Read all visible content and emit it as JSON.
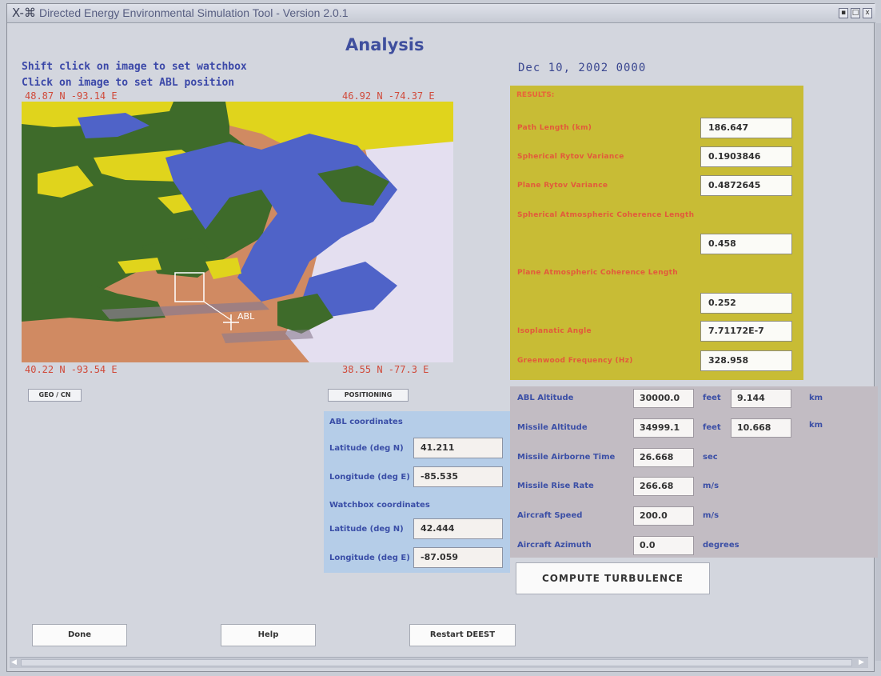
{
  "window": {
    "title": "Directed Energy Environmental Simulation Tool - Version 2.0.1",
    "controls": [
      "▪",
      "□",
      "x"
    ]
  },
  "heading": "Analysis",
  "instructions": {
    "watchbox": "Shift click on image to set watchbox",
    "abl": "Click on image to set ABL position"
  },
  "map": {
    "corners": {
      "top_left": "48.87 N  -93.14 E",
      "top_right": "46.92 N  -74.37 E",
      "bottom_left": "40.22 N  -93.54 E",
      "bottom_right": "38.55 N  -77.3 E"
    },
    "abl_marker_label": "ABL",
    "colors": {
      "water": "#4f63c8",
      "forest": "#3e6b2a",
      "crop": "#e0d41c",
      "land": "#d08a62",
      "snow": "#e4dff0",
      "urban": "#8a7b8f"
    }
  },
  "date": "Dec 10, 2002    0000",
  "geo_button": "GEO / CN",
  "positioning_button": "POSITIONING",
  "results": {
    "title": "RESULTS:",
    "items": [
      {
        "label": "Path Length (km)",
        "value": "186.647"
      },
      {
        "label": "Spherical Rytov Variance",
        "value": "0.1903846"
      },
      {
        "label": "Plane Rytov Variance",
        "value": "0.4872645"
      },
      {
        "label": "Spherical Atmospheric Coherence Length",
        "value": "0.458"
      },
      {
        "label": "Plane Atmospheric Coherence Length",
        "value": "0.252"
      },
      {
        "label": "Isoplanatic Angle",
        "value": "7.71172E-7"
      },
      {
        "label": "Greenwood Frequency (Hz)",
        "value": "328.958"
      }
    ]
  },
  "positioning": {
    "abl_heading": "ABL coordinates",
    "abl_lat_label": "Latitude (deg N)",
    "abl_lat_value": "41.211",
    "abl_lon_label": "Longitude (deg E)",
    "abl_lon_value": "-85.535",
    "watch_heading": "Watchbox coordinates",
    "watch_lat_label": "Latitude (deg N)",
    "watch_lat_value": "42.444",
    "watch_lon_label": "Longitude (deg E)",
    "watch_lon_value": "-87.059"
  },
  "parameters": {
    "abl_altitude": {
      "label": "ABL Altitude",
      "value1": "30000.0",
      "unit1": "feet",
      "value2": "9.144",
      "unit2": "km"
    },
    "missile_altitude": {
      "label": "Missile Altitude",
      "value1": "34999.1",
      "unit1": "feet",
      "value2": "10.668",
      "unit2": "km"
    },
    "missile_airborne_time": {
      "label": "Missile Airborne Time",
      "value": "26.668",
      "unit": "sec"
    },
    "missile_rise_rate": {
      "label": "Missile Rise Rate",
      "value": "266.68",
      "unit": "m/s"
    },
    "aircraft_speed": {
      "label": "Aircraft Speed",
      "value": "200.0",
      "unit": "m/s"
    },
    "aircraft_azimuth": {
      "label": "Aircraft Azimuth",
      "value": "0.0",
      "unit": "degrees"
    }
  },
  "compute_button": "COMPUTE TURBULENCE",
  "buttons": {
    "done": "Done",
    "help": "Help",
    "restart": "Restart DEEST"
  }
}
